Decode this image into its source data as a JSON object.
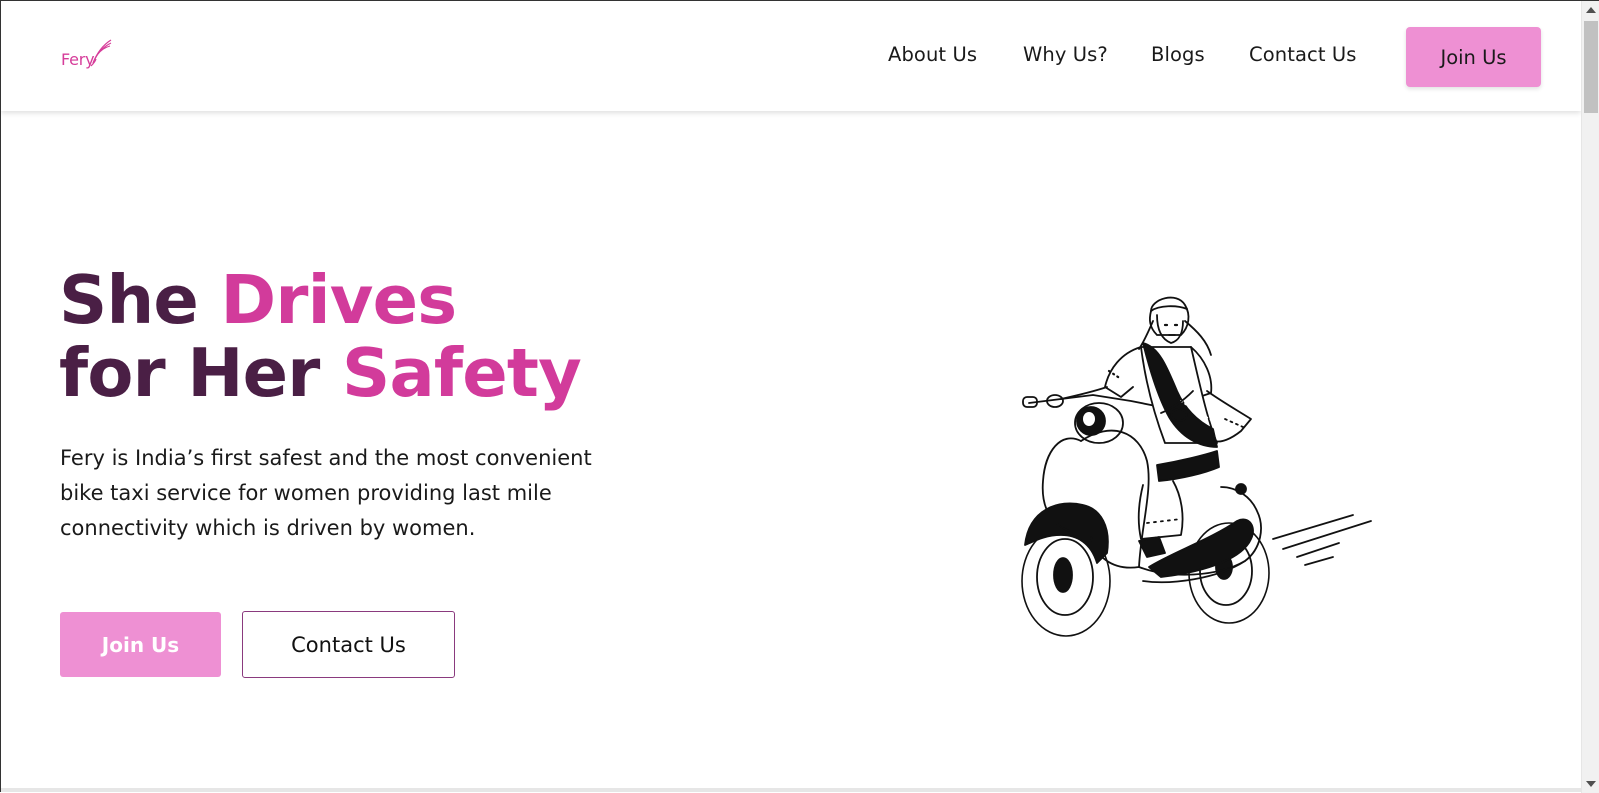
{
  "brand": {
    "name": "Fery",
    "color": "#d63d9a"
  },
  "nav": {
    "links": [
      "About Us",
      "Why Us?",
      "Blogs",
      "Contact Us"
    ],
    "join_label": "Join Us"
  },
  "hero": {
    "line1_dark": "She ",
    "line1_pink": "Drives",
    "line2_dark": "for Her ",
    "line2_pink": "Safety",
    "description": "Fery is India’s first safest and the most convenient bike taxi service for women providing last mile connectivity which is driven by women.",
    "primary_button": "Join Us",
    "secondary_button": "Contact Us"
  },
  "colors": {
    "accent_pink": "#ee90d3",
    "headline_dark": "#4a1f45",
    "headline_pink": "#d23b9b"
  },
  "icons": {
    "logo": "wing-logo-icon",
    "illustration": "woman-riding-scooter-illustration"
  }
}
